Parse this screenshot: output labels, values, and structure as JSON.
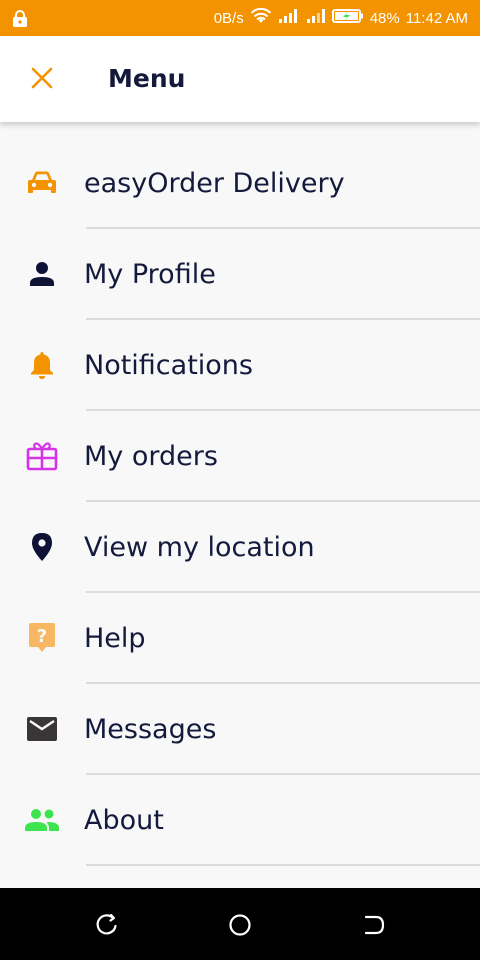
{
  "status_bar": {
    "net_speed": "0B/s",
    "battery": "48%",
    "time": "11:42 AM"
  },
  "header": {
    "title": "Menu",
    "close_icon": "close-icon"
  },
  "menu": {
    "items": [
      {
        "label": "easyOrder Delivery",
        "icon": "car-icon",
        "color": "#f39300"
      },
      {
        "label": "My Profile",
        "icon": "person-icon",
        "color": "#0e1235"
      },
      {
        "label": "Notifications",
        "icon": "bell-icon",
        "color": "#f39300"
      },
      {
        "label": "My orders",
        "icon": "gift-box-icon",
        "color": "#d633e8"
      },
      {
        "label": "View my location",
        "icon": "location-pin-icon",
        "color": "#0e1235"
      },
      {
        "label": "Help",
        "icon": "help-icon",
        "color": "#f8b863"
      },
      {
        "label": "Messages",
        "icon": "mail-icon",
        "color": "#3a3537"
      },
      {
        "label": "About",
        "icon": "people-icon",
        "color": "#3ee44e"
      }
    ]
  },
  "nav_bar": {
    "back_icon": "recent-apps-icon",
    "home_icon": "home-icon",
    "recents_icon": "back-icon"
  }
}
